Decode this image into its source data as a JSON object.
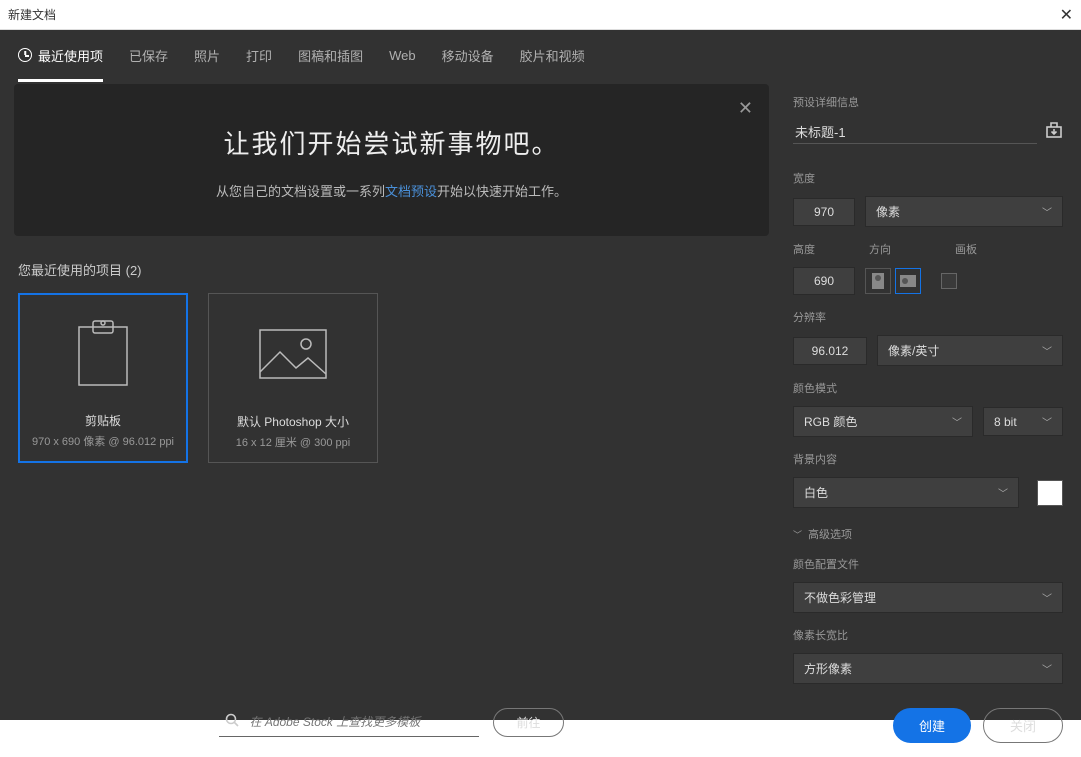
{
  "window": {
    "title": "新建文档"
  },
  "tabs": [
    {
      "label": "最近使用项",
      "active": true
    },
    {
      "label": "已保存"
    },
    {
      "label": "照片"
    },
    {
      "label": "打印"
    },
    {
      "label": "图稿和插图"
    },
    {
      "label": "Web"
    },
    {
      "label": "移动设备"
    },
    {
      "label": "胶片和视频"
    }
  ],
  "hero": {
    "title": "让我们开始尝试新事物吧。",
    "sub_pre": "从您自己的文档设置或一系列",
    "sub_link": "文档预设",
    "sub_post": "开始以快速开始工作。"
  },
  "recent_label": "您最近使用的项目 (2)",
  "cards": [
    {
      "title": "剪贴板",
      "meta": "970 x 690 像素 @ 96.012 ppi",
      "selected": true,
      "icon": "clipboard"
    },
    {
      "title": "默认 Photoshop 大小",
      "meta": "16 x 12 厘米 @ 300 ppi",
      "selected": false,
      "icon": "image"
    }
  ],
  "search": {
    "placeholder": "在 Adobe Stock 上查找更多模板",
    "go": "前往"
  },
  "panel": {
    "header": "预设详细信息",
    "name": "未标题-1",
    "width_label": "宽度",
    "width_value": "970",
    "width_unit": "像素",
    "height_label": "高度",
    "orient_label": "方向",
    "artboard_label": "画板",
    "height_value": "690",
    "res_label": "分辨率",
    "res_value": "96.012",
    "res_unit": "像素/英寸",
    "colormode_label": "颜色模式",
    "colormode_value": "RGB 颜色",
    "depth_value": "8 bit",
    "bg_label": "背景内容",
    "bg_value": "白色",
    "adv_label": "高级选项",
    "profile_label": "颜色配置文件",
    "profile_value": "不做色彩管理",
    "aspect_label": "像素长宽比",
    "aspect_value": "方形像素"
  },
  "footer": {
    "create": "创建",
    "close": "关闭"
  }
}
